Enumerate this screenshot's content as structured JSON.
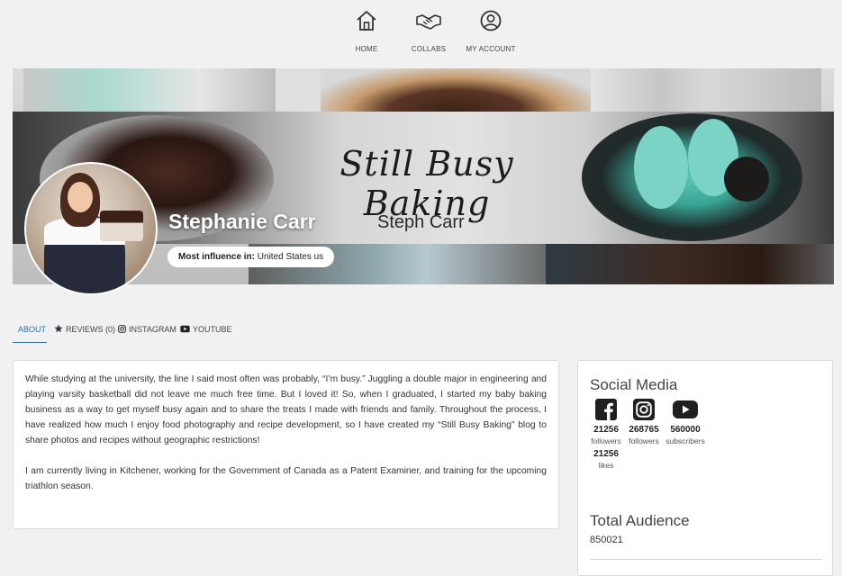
{
  "nav": {
    "items": [
      {
        "label": "HOME",
        "icon": "home-icon"
      },
      {
        "label": "COLLABS",
        "icon": "handshake-icon"
      },
      {
        "label": "MY ACCOUNT",
        "icon": "account-icon"
      }
    ]
  },
  "banner": {
    "script_title": "Still Busy Baking",
    "script_subtitle": "Steph Carr"
  },
  "profile": {
    "name": "Stephanie Carr",
    "influence_label": "Most influence in:",
    "influence_value": "United States us"
  },
  "tabs": [
    {
      "label": "ABOUT",
      "icon": "",
      "active": true
    },
    {
      "label": "REVIEWS (0)",
      "icon": "star-icon",
      "active": false
    },
    {
      "label": "INSTAGRAM",
      "icon": "instagram-icon",
      "active": false
    },
    {
      "label": "YOUTUBE",
      "icon": "youtube-icon",
      "active": false
    }
  ],
  "about": {
    "paragraphs": [
      "While studying at the university, the line I said most often was probably, “I’m busy.” Juggling a double major in engineering and playing varsity basketball did not leave me much free time. But I loved it! So, when I graduated, I started my baby baking business as a way to get myself busy again and to share the treats I made with friends and family. Throughout the process, I have realized how much I enjoy food photography and recipe development, so I have created my “Still Busy Baking” blog to share photos and recipes without geographic restrictions!",
      "I am currently living in Kitchener, working for the Government of Canada as a Patent Examiner, and training for the upcoming triathlon season."
    ]
  },
  "social": {
    "title": "Social Media",
    "platforms": [
      {
        "icon": "facebook-icon",
        "count": "21256",
        "unit": "followers",
        "count2": "21256",
        "unit2": "likes"
      },
      {
        "icon": "instagram-icon",
        "count": "268765",
        "unit": "followers"
      },
      {
        "icon": "youtube-icon",
        "count": "560000",
        "unit": "subscribers"
      }
    ]
  },
  "audience": {
    "title": "Total Audience",
    "value": "850021"
  },
  "colors": {
    "accent": "#2f6eaa",
    "background": "#f1f1f1",
    "card": "#ffffff",
    "frosting": "#58c5b6"
  }
}
